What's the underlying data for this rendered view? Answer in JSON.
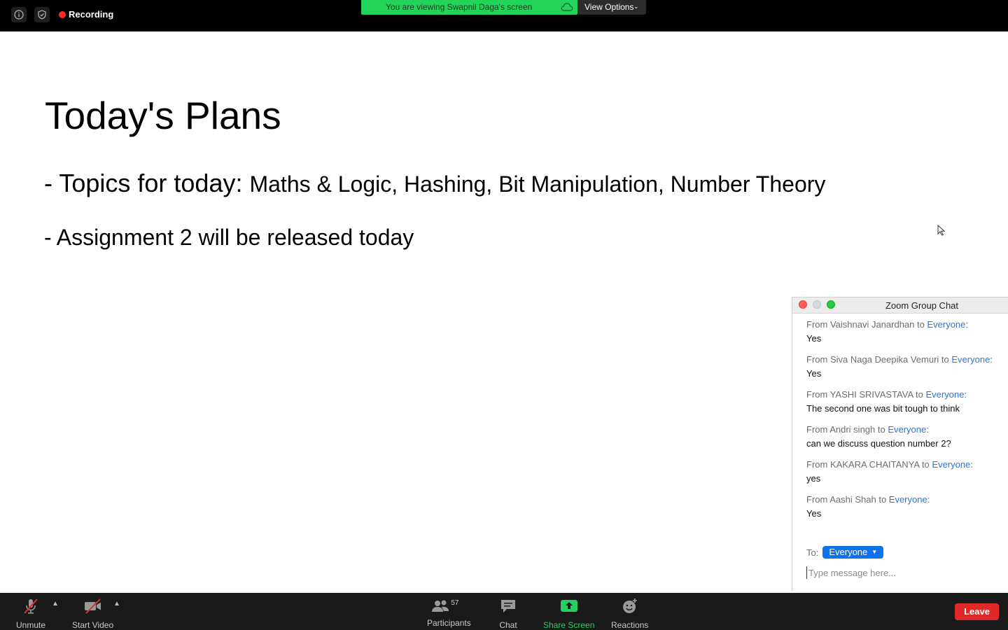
{
  "topbar": {
    "recording_label": "Recording",
    "viewing_text": "You are viewing Swapnil Daga's screen",
    "view_options_label": "View Options",
    "icons": [
      "info-icon",
      "shield-icon",
      "cloud-icon"
    ]
  },
  "slide": {
    "title": "Today's Plans",
    "bullet1_prefix": "- Topics for today: ",
    "bullet1_topics": "Maths & Logic, Hashing, Bit Manipulation, Number Theory",
    "bullet2": "- Assignment 2 will be released today"
  },
  "chat": {
    "window_title": "Zoom Group Chat",
    "messages": [
      {
        "from": "From Vaishnavi Janardhan to ",
        "to": "Everyone",
        "suffix": ":",
        "text": "Yes"
      },
      {
        "from": "From Siva Naga Deepika Vemuri to ",
        "to": "Everyone",
        "suffix": ":",
        "text": "Yes"
      },
      {
        "from": "From YASHI SRIVASTAVA to ",
        "to": "Everyone",
        "suffix": ":",
        "text": "The second one was bit tough to think"
      },
      {
        "from": "From Andri singh to ",
        "to": "Everyone",
        "suffix": ":",
        "text": "can we discuss question number 2?"
      },
      {
        "from": "From KAKARA CHAITANYA to ",
        "to": "Everyone",
        "suffix": ":",
        "text": "yes"
      },
      {
        "from": "From Aashi Shah to ",
        "to": "Everyone",
        "suffix": ":",
        "text": "Yes"
      }
    ],
    "to_label": "To:",
    "to_value": "Everyone",
    "input_placeholder": "Type message here..."
  },
  "toolbar": {
    "unmute_label": "Unmute",
    "start_video_label": "Start Video",
    "participants_label": "Participants",
    "participants_count": "57",
    "chat_label": "Chat",
    "share_screen_label": "Share Screen",
    "reactions_label": "Reactions",
    "leave_label": "Leave"
  },
  "colors": {
    "viewing_banner": "#24d35a",
    "share_screen_accent": "#23d160",
    "leave_button": "#e02828",
    "chat_link": "#2d74d8",
    "to_pill": "#0e72ed"
  }
}
